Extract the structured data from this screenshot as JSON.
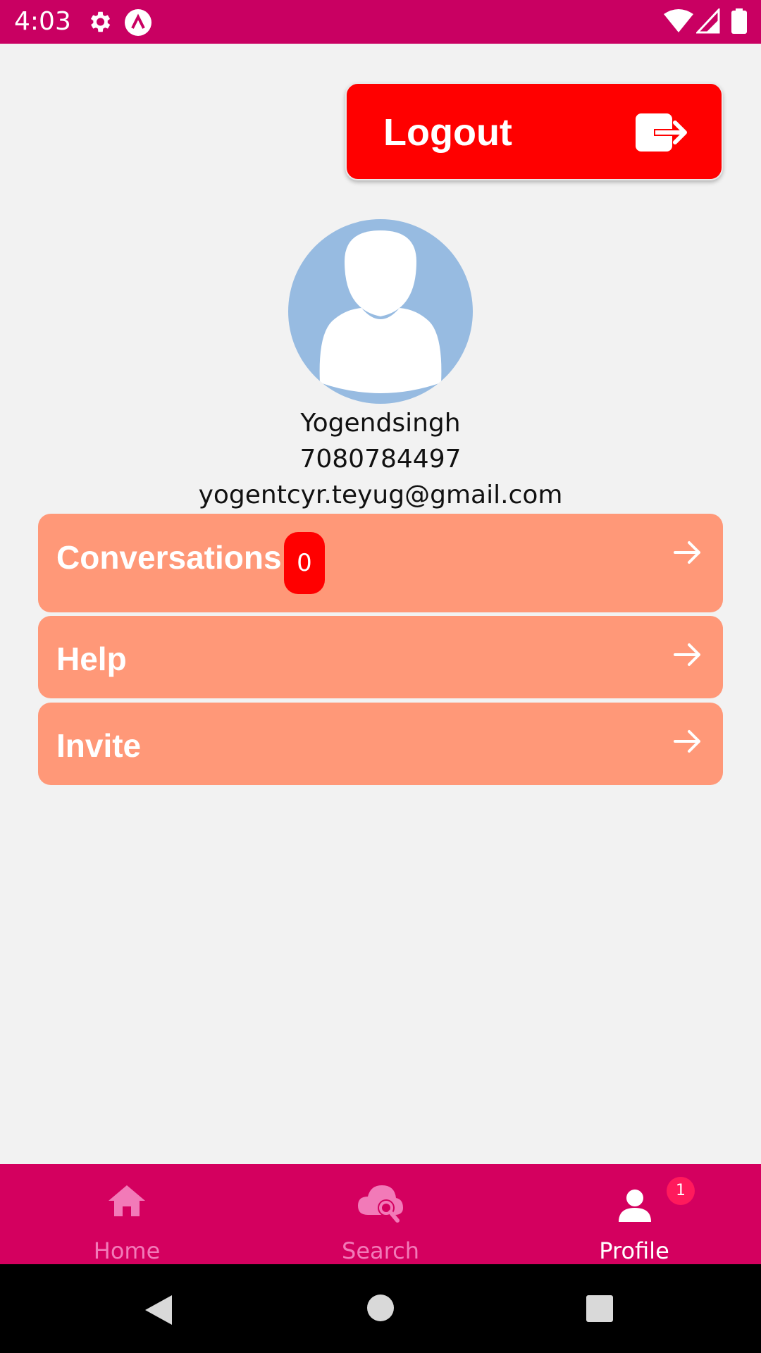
{
  "status_bar": {
    "time": "4:03",
    "icons": [
      "gear-icon",
      "app-notification-icon",
      "wifi-icon",
      "signal-icon",
      "battery-icon"
    ]
  },
  "logout": {
    "label": "Logout",
    "icon": "logout-icon"
  },
  "profile": {
    "name": "Yogendsingh",
    "phone": "7080784497",
    "email": "yogentcyr.teyug@gmail.com"
  },
  "menu": [
    {
      "label": "Conversations",
      "badge": "0"
    },
    {
      "label": "Help"
    },
    {
      "label": "Invite"
    }
  ],
  "bottom_nav": {
    "items": [
      {
        "label": "Home",
        "icon": "home-icon"
      },
      {
        "label": "Search",
        "icon": "cloud-search-icon"
      },
      {
        "label": "Profile",
        "icon": "person-icon",
        "badge": "1",
        "active": true
      }
    ]
  },
  "colors": {
    "status_bar": "#c90062",
    "logout_button": "#ff0000",
    "menu_row": "#ff9878",
    "bottom_nav": "#d4005f",
    "avatar_bg": "#97bbe1"
  }
}
